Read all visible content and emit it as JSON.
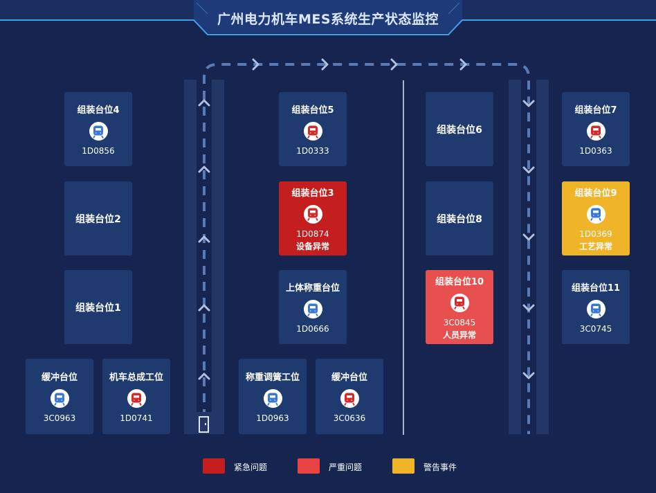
{
  "header": {
    "title": "广州电力机车MES系统生产状态监控"
  },
  "colors": {
    "normal": "#1e3a6e",
    "urgent": "#c41e1e",
    "serious": "#e85050",
    "warning": "#f0b429",
    "train_blue": "#3a78d8",
    "train_red": "#d42a2a"
  },
  "stations": {
    "s4": {
      "name": "组装台位4",
      "code": "1D0856",
      "icon": "train-icon-blue"
    },
    "s2": {
      "name": "组装台位2"
    },
    "s1": {
      "name": "组装台位1"
    },
    "buffer_left": {
      "name": "缓冲台位",
      "code": "3C0963",
      "icon": "train-icon-blue"
    },
    "final_assembly": {
      "name": "机车总成工位",
      "code": "1D0741",
      "icon": "train-icon-red"
    },
    "s5": {
      "name": "组装台位5",
      "code": "1D0333",
      "icon": "train-icon-red"
    },
    "s3": {
      "name": "组装台位3",
      "code": "1D0874",
      "status": "设备异常",
      "icon": "train-icon-red"
    },
    "upper_weigh": {
      "name": "上体称重台位",
      "code": "1D0666",
      "icon": "train-icon-blue"
    },
    "weigh_adjust": {
      "name": "称重调簧工位",
      "code": "1D0963",
      "icon": "train-icon-blue"
    },
    "buffer_mid": {
      "name": "缓冲台位",
      "code": "3C0636",
      "icon": "train-icon-red"
    },
    "s6": {
      "name": "组装台位6"
    },
    "s8": {
      "name": "组装台位8"
    },
    "s10": {
      "name": "组装台位10",
      "code": "3C0845",
      "status": "人员异常",
      "icon": "train-icon-red"
    },
    "s7": {
      "name": "组装台位7",
      "code": "1D0363",
      "icon": "train-icon-red"
    },
    "s9": {
      "name": "组装台位9",
      "code": "1D0369",
      "status": "工艺异常",
      "icon": "train-icon-blue"
    },
    "s11": {
      "name": "组装台位11",
      "code": "3C0745",
      "icon": "train-icon-blue"
    }
  },
  "legend": [
    {
      "label": "紧急问题",
      "color": "#c41e1e"
    },
    {
      "label": "严重问题",
      "color": "#e85050"
    },
    {
      "label": "警告事件",
      "color": "#f0b429"
    }
  ]
}
